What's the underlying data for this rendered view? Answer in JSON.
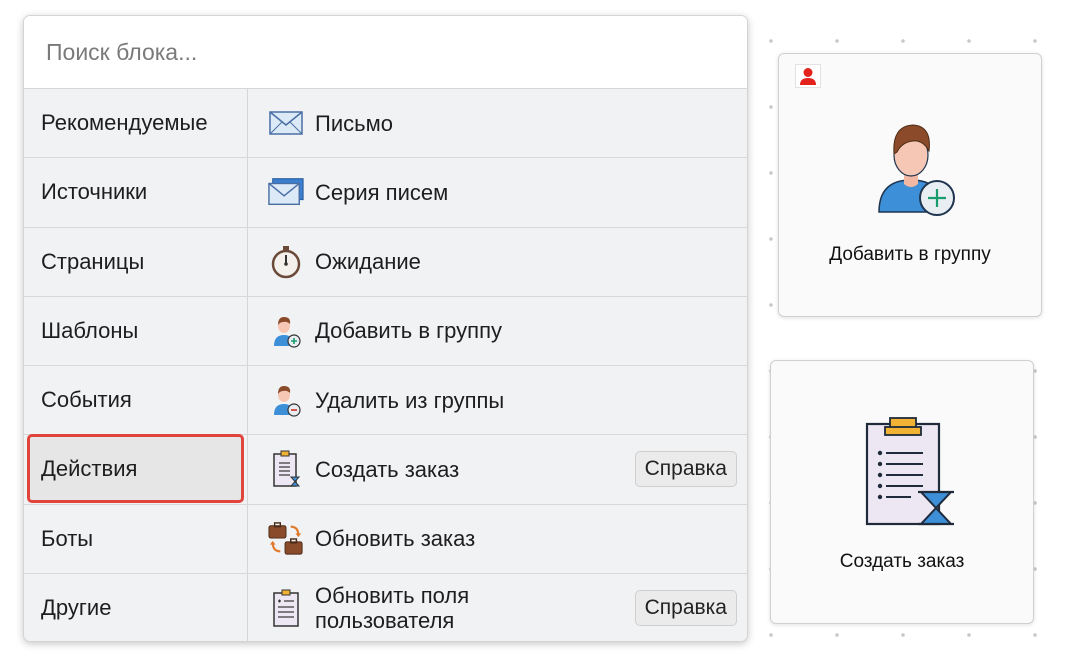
{
  "search": {
    "placeholder": "Поиск блока..."
  },
  "categories": [
    {
      "label": "Рекомендуемые"
    },
    {
      "label": "Источники"
    },
    {
      "label": "Страницы"
    },
    {
      "label": "Шаблоны"
    },
    {
      "label": "События"
    },
    {
      "label": "Действия",
      "selected": true
    },
    {
      "label": "Боты"
    },
    {
      "label": "Другие"
    }
  ],
  "blocks": [
    {
      "label": "Письмо",
      "icon": "envelope-icon"
    },
    {
      "label": "Серия писем",
      "icon": "envelope-series-icon"
    },
    {
      "label": "Ожидание",
      "icon": "stopwatch-icon"
    },
    {
      "label": "Добавить в группу",
      "icon": "user-add-icon"
    },
    {
      "label": "Удалить из группы",
      "icon": "user-remove-icon"
    },
    {
      "label": "Создать заказ",
      "icon": "clipboard-hourglass-icon",
      "help": "Справка"
    },
    {
      "label": "Обновить заказ",
      "icon": "briefcase-sync-icon"
    },
    {
      "label_line1": "Обновить поля",
      "label_line2": "пользователя",
      "icon": "clipboard-fields-icon",
      "help": "Справка"
    }
  ],
  "canvas_cards": [
    {
      "label": "Добавить в группу",
      "icon": "user-add-icon",
      "badge": "user-badge-icon"
    },
    {
      "label": "Создать заказ",
      "icon": "clipboard-hourglass-icon"
    }
  ],
  "colors": {
    "selection_border": "#e0443a",
    "panel_bg": "#f1f2f4"
  }
}
